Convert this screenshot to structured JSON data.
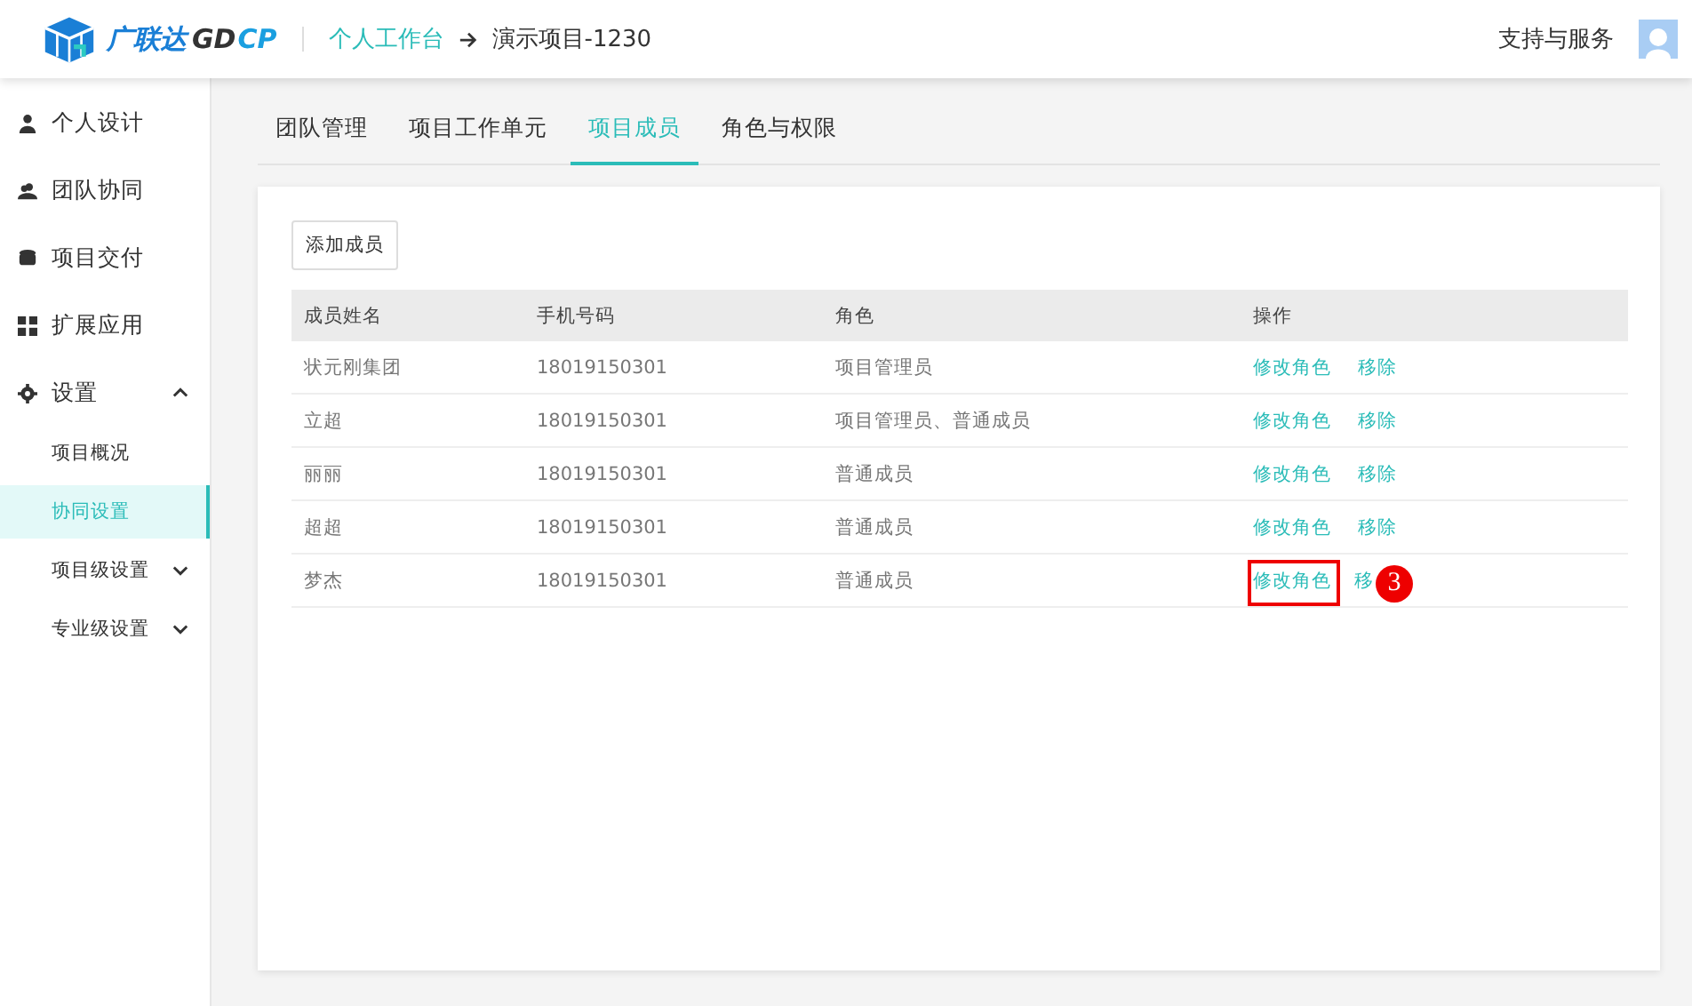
{
  "header": {
    "logo_text": "广联达",
    "logo_brand": "GD",
    "logo_brand_accent": "CP",
    "breadcrumb": [
      {
        "label": "个人工作台",
        "selected": false
      },
      {
        "label": "演示项目-1230",
        "selected": true
      }
    ],
    "support": "支持与服务"
  },
  "sidebar": {
    "items": [
      {
        "label": "个人设计",
        "kind": "user"
      },
      {
        "label": "团队协同",
        "kind": "team"
      },
      {
        "label": "项目交付",
        "kind": "stack"
      },
      {
        "label": "扩展应用",
        "kind": "grid"
      },
      {
        "label": "设置",
        "kind": "gear",
        "expanded": true,
        "children": [
          {
            "label": "项目概况",
            "selected": false
          },
          {
            "label": "协同设置",
            "selected": true
          },
          {
            "label": "项目级设置",
            "selected": false,
            "expanded": false
          },
          {
            "label": "专业级设置",
            "selected": false,
            "expanded": false
          }
        ]
      }
    ]
  },
  "tabs": [
    {
      "label": "团队管理",
      "selected": false
    },
    {
      "label": "项目工作单元",
      "selected": false
    },
    {
      "label": "项目成员",
      "selected": true
    },
    {
      "label": "角色与权限",
      "selected": false
    }
  ],
  "add_button": "添加成员",
  "table": {
    "columns": [
      "成员姓名",
      "手机号码",
      "角色",
      "操作"
    ],
    "rows": [
      {
        "name": "状元刚集团",
        "phone": "18019150301",
        "role": "项目管理员",
        "edit": "修改角色",
        "remove": "移除"
      },
      {
        "name": "立超",
        "phone": "18019150301",
        "role": "项目管理员、普通成员",
        "edit": "修改角色",
        "remove": "移除"
      },
      {
        "name": "丽丽",
        "phone": "18019150301",
        "role": "普通成员",
        "edit": "修改角色",
        "remove": "移除"
      },
      {
        "name": "超超",
        "phone": "18019150301",
        "role": "普通成员",
        "edit": "修改角色",
        "remove": "移除"
      },
      {
        "name": "梦杰",
        "phone": "18019150301",
        "role": "普通成员",
        "edit": "修改角色",
        "remove": "移",
        "callout": "3"
      }
    ]
  }
}
